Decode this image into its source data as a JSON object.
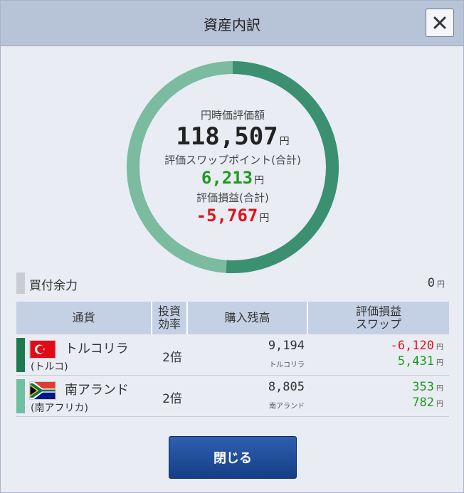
{
  "window": {
    "title": "資産内訳",
    "close_icon": "close-icon"
  },
  "summary": {
    "yen_label": "円時価評価額",
    "yen_value": "118,507",
    "yen_unit": "円",
    "swap_label": "評価スワップポイント(合計)",
    "swap_value": "6,213",
    "swap_unit": "円",
    "pl_label": "評価損益(合計)",
    "pl_value": "-5,767",
    "pl_unit": "円"
  },
  "donut": {
    "colors": {
      "turkey": "#3b9072",
      "southafrica": "#7bbba0",
      "track_dark": "#2f7e63"
    },
    "share": {
      "turkey": 0.51,
      "southafrica": 0.49
    }
  },
  "buying_power": {
    "label": "買付余力",
    "value": "0",
    "unit": "円"
  },
  "table": {
    "headers": {
      "currency": "通貨",
      "leverage": "投資\n効率",
      "position": "購入残高",
      "pl_swap": "評価損益\nスワップ"
    },
    "rows": [
      {
        "name": "トルコリラ",
        "country": "(トルコ)",
        "flag": "turkey-flag",
        "leverage": "2倍",
        "position": "9,194",
        "position_unit": "トルコリラ",
        "pl": "-6,120",
        "pl_color": "#e0121b",
        "swap": "5,431",
        "unit": "円",
        "stripe_color": "#1e7a4e"
      },
      {
        "name": "南アランド",
        "country": "(南アフリカ)",
        "flag": "south-africa-flag",
        "leverage": "2倍",
        "position": "8,805",
        "position_unit": "南アランド",
        "pl": "353",
        "pl_color": "#1f9a1f",
        "swap": "782",
        "unit": "円",
        "stripe_color": "#6fbfa0"
      }
    ]
  },
  "close_button": {
    "label": "閉じる"
  }
}
